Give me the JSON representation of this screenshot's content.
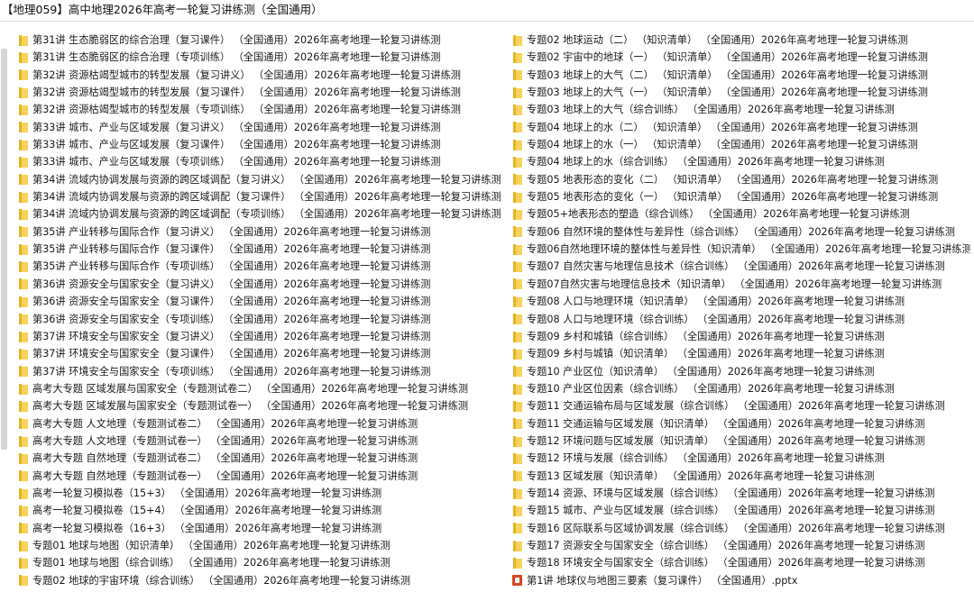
{
  "window": {
    "title": "【地理059】高中地理2026年高考一轮复习讲练测（全国通用）"
  },
  "left_items": [
    {
      "icon": "folder-icon",
      "label": "第31讲 生态脆弱区的综合治理（复习课件） （全国通用）2026年高考地理一轮复习讲练测"
    },
    {
      "icon": "folder-icon",
      "label": "第31讲 生态脆弱区的综合治理（专项训练） （全国通用）2026年高考地理一轮复习讲练测"
    },
    {
      "icon": "folder-icon",
      "label": "第32讲 资源枯竭型城市的转型发展（复习讲义） （全国通用）2026年高考地理一轮复习讲练测"
    },
    {
      "icon": "folder-icon",
      "label": "第32讲 资源枯竭型城市的转型发展（复习课件） （全国通用）2026年高考地理一轮复习讲练测"
    },
    {
      "icon": "folder-icon",
      "label": "第32讲 资源枯竭型城市的转型发展（专项训练） （全国通用）2026年高考地理一轮复习讲练测"
    },
    {
      "icon": "folder-icon",
      "label": "第33讲 城市、产业与区域发展（复习讲义） （全国通用）2026年高考地理一轮复习讲练测"
    },
    {
      "icon": "folder-icon",
      "label": "第33讲 城市、产业与区域发展（复习课件） （全国通用）2026年高考地理一轮复习讲练测"
    },
    {
      "icon": "folder-icon",
      "label": "第33讲 城市、产业与区域发展（专项训练） （全国通用）2026年高考地理一轮复习讲练测"
    },
    {
      "icon": "folder-icon",
      "label": "第34讲 流域内协调发展与资源的跨区域调配（复习讲义） （全国通用）2026年高考地理一轮复习讲练测"
    },
    {
      "icon": "folder-icon",
      "label": "第34讲 流域内协调发展与资源的跨区域调配（复习课件） （全国通用）2026年高考地理一轮复习讲练测"
    },
    {
      "icon": "folder-icon",
      "label": "第34讲 流域内协调发展与资源的跨区域调配（专项训练） （全国通用）2026年高考地理一轮复习讲练测"
    },
    {
      "icon": "folder-icon",
      "label": "第35讲 产业转移与国际合作（复习讲义） （全国通用）2026年高考地理一轮复习讲练测"
    },
    {
      "icon": "folder-icon",
      "label": "第35讲 产业转移与国际合作（复习课件） （全国通用）2026年高考地理一轮复习讲练测"
    },
    {
      "icon": "folder-icon",
      "label": "第35讲 产业转移与国际合作（专项训练） （全国通用）2026年高考地理一轮复习讲练测"
    },
    {
      "icon": "folder-icon",
      "label": "第36讲 资源安全与国家安全（复习讲义） （全国通用）2026年高考地理一轮复习讲练测"
    },
    {
      "icon": "folder-icon",
      "label": "第36讲 资源安全与国家安全（复习课件） （全国通用）2026年高考地理一轮复习讲练测"
    },
    {
      "icon": "folder-icon",
      "label": "第36讲 资源安全与国家安全（专项训练） （全国通用）2026年高考地理一轮复习讲练测"
    },
    {
      "icon": "folder-icon",
      "label": "第37讲 环境安全与国家安全（复习讲义） （全国通用）2026年高考地理一轮复习讲练测"
    },
    {
      "icon": "folder-icon",
      "label": "第37讲 环境安全与国家安全（复习课件） （全国通用）2026年高考地理一轮复习讲练测"
    },
    {
      "icon": "folder-icon",
      "label": "第37讲 环境安全与国家安全（专项训练） （全国通用）2026年高考地理一轮复习讲练测"
    },
    {
      "icon": "folder-icon",
      "label": "高考大专题 区域发展与国家安全（专题测试卷二） （全国通用）2026年高考地理一轮复习讲练测"
    },
    {
      "icon": "folder-icon",
      "label": "高考大专题 区域发展与国家安全（专题测试卷一） （全国通用）2026年高考地理一轮复习讲练测"
    },
    {
      "icon": "folder-icon",
      "label": "高考大专题 人文地理（专题测试卷二） （全国通用）2026年高考地理一轮复习讲练测"
    },
    {
      "icon": "folder-icon",
      "label": "高考大专题 人文地理（专题测试卷一） （全国通用）2026年高考地理一轮复习讲练测"
    },
    {
      "icon": "folder-icon",
      "label": "高考大专题 自然地理（专题测试卷二） （全国通用）2026年高考地理一轮复习讲练测"
    },
    {
      "icon": "folder-icon",
      "label": "高考大专题 自然地理（专题测试卷一） （全国通用）2026年高考地理一轮复习讲练测"
    },
    {
      "icon": "folder-icon",
      "label": "高考一轮复习模拟卷（15+3） （全国通用）2026年高考地理一轮复习讲练测"
    },
    {
      "icon": "folder-icon",
      "label": "高考一轮复习模拟卷（15+4） （全国通用）2026年高考地理一轮复习讲练测"
    },
    {
      "icon": "folder-icon",
      "label": "高考一轮复习模拟卷（16+3） （全国通用）2026年高考地理一轮复习讲练测"
    },
    {
      "icon": "folder-icon",
      "label": "专题01 地球与地图（知识清单） （全国通用）2026年高考地理一轮复习讲练测"
    },
    {
      "icon": "folder-icon",
      "label": "专题01 地球与地图（综合训练） （全国通用）2026年高考地理一轮复习讲练测"
    },
    {
      "icon": "folder-icon",
      "label": "专题02 地球的宇宙环境（综合训练） （全国通用）2026年高考地理一轮复习讲练测"
    }
  ],
  "right_items": [
    {
      "icon": "folder-icon",
      "label": "专题02 地球运动（二） （知识清单） （全国通用）2026年高考地理一轮复习讲练测"
    },
    {
      "icon": "folder-icon",
      "label": "专题02 宇宙中的地球（一） （知识清单） （全国通用）2026年高考地理一轮复习讲练测"
    },
    {
      "icon": "folder-icon",
      "label": "专题03 地球上的大气（二） （知识清单） （全国通用）2026年高考地理一轮复习讲练测"
    },
    {
      "icon": "folder-icon",
      "label": "专题03 地球上的大气（一） （知识清单） （全国通用）2026年高考地理一轮复习讲练测"
    },
    {
      "icon": "folder-icon",
      "label": "专题03 地球上的大气（综合训练） （全国通用）2026年高考地理一轮复习讲练测"
    },
    {
      "icon": "folder-icon",
      "label": "专题04 地球上的水（二） （知识清单） （全国通用）2026年高考地理一轮复习讲练测"
    },
    {
      "icon": "folder-icon",
      "label": "专题04 地球上的水（一） （知识清单） （全国通用）2026年高考地理一轮复习讲练测"
    },
    {
      "icon": "folder-icon",
      "label": "专题04 地球上的水（综合训练） （全国通用）2026年高考地理一轮复习讲练测"
    },
    {
      "icon": "folder-icon",
      "label": "专题05 地表形态的变化（二） （知识清单） （全国通用）2026年高考地理一轮复习讲练测"
    },
    {
      "icon": "folder-icon",
      "label": "专题05 地表形态的变化（一） （知识清单） （全国通用）2026年高考地理一轮复习讲练测"
    },
    {
      "icon": "folder-icon",
      "label": "专题05+地表形态的塑造（综合训练） （全国通用）2026年高考地理一轮复习讲练测"
    },
    {
      "icon": "folder-icon",
      "label": "专题06 自然环境的整体性与差异性（综合训练） （全国通用）2026年高考地理一轮复习讲练测"
    },
    {
      "icon": "folder-icon",
      "label": "专题06自然地理环境的整体性与差异性（知识清单） （全国通用）2026年高考地理一轮复习讲练测"
    },
    {
      "icon": "folder-icon",
      "label": "专题07 自然灾害与地理信息技术（综合训练） （全国通用）2026年高考地理一轮复习讲练测"
    },
    {
      "icon": "folder-icon",
      "label": "专题07自然灾害与地理信息技术（知识清单） （全国通用）2026年高考地理一轮复习讲练测"
    },
    {
      "icon": "folder-icon",
      "label": "专题08 人口与地理环境（知识清单） （全国通用）2026年高考地理一轮复习讲练测"
    },
    {
      "icon": "folder-icon",
      "label": "专题08 人口与地理环境（综合训练） （全国通用）2026年高考地理一轮复习讲练测"
    },
    {
      "icon": "folder-icon",
      "label": "专题09 乡村和城镇（综合训练） （全国通用）2026年高考地理一轮复习讲练测"
    },
    {
      "icon": "folder-icon",
      "label": "专题09 乡村与城镇（知识清单） （全国通用）2026年高考地理一轮复习讲练测"
    },
    {
      "icon": "folder-icon",
      "label": "专题10 产业区位（知识清单） （全国通用）2026年高考地理一轮复习讲练测"
    },
    {
      "icon": "folder-icon",
      "label": "专题10 产业区位因素（综合训练） （全国通用）2026年高考地理一轮复习讲练测"
    },
    {
      "icon": "folder-icon",
      "label": "专题11 交通运输布局与区域发展（综合训练） （全国通用）2026年高考地理一轮复习讲练测"
    },
    {
      "icon": "folder-icon",
      "label": "专题11 交通运输与区域发展（知识清单） （全国通用）2026年高考地理一轮复习讲练测"
    },
    {
      "icon": "folder-icon",
      "label": "专题12 环境问题与区域发展（知识清单） （全国通用）2026年高考地理一轮复习讲练测"
    },
    {
      "icon": "folder-icon",
      "label": "专题12 环境与发展（综合训练） （全国通用）2026年高考地理一轮复习讲练测"
    },
    {
      "icon": "folder-icon",
      "label": "专题13 区域发展（知识清单） （全国通用）2026年高考地理一轮复习讲练测"
    },
    {
      "icon": "folder-icon",
      "label": "专题14 资源、环境与区域发展（综合训练） （全国通用）2026年高考地理一轮复习讲练测"
    },
    {
      "icon": "folder-icon",
      "label": "专题15 城市、产业与区域发展（综合训练） （全国通用）2026年高考地理一轮复习讲练测"
    },
    {
      "icon": "folder-icon",
      "label": "专题16 区际联系与区域协调发展（综合训练） （全国通用）2026年高考地理一轮复习讲练测"
    },
    {
      "icon": "folder-icon",
      "label": "专题17 资源安全与国家安全（综合训练） （全国通用）2026年高考地理一轮复习讲练测"
    },
    {
      "icon": "folder-icon",
      "label": "专题18 环境安全与国家安全（综合训练） （全国通用）2026年高考地理一轮复习讲练测"
    },
    {
      "icon": "pptx-icon",
      "label": "第1讲 地球仪与地图三要素（复习课件） （全国通用）.pptx"
    }
  ],
  "colors": {
    "folder_tab": "#e6b422",
    "folder_body": "#f7d35c",
    "pptx_icon": "#d24726",
    "scroll_thumb": "#d6d6d6"
  }
}
